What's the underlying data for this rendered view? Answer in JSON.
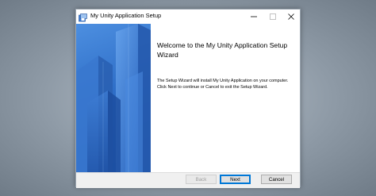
{
  "window": {
    "title": "My Unity Application Setup",
    "icons": {
      "app": "installer-icon",
      "minimize": "minimize-icon",
      "maximize": "maximize-icon",
      "close": "close-icon"
    }
  },
  "banner": {
    "image": "blue-buildings-graphic"
  },
  "content": {
    "heading": "Welcome to the My Unity Application Setup Wizard",
    "body": "The Setup Wizard will install My Unity Application on your computer. Click Next to continue or Cancel to exit the Setup Wizard."
  },
  "footer": {
    "back_label": "Back",
    "next_label": "Next",
    "cancel_label": "Cancel"
  },
  "colors": {
    "banner_blue": "#2f6fc8",
    "default_button_border": "#0078d7"
  }
}
